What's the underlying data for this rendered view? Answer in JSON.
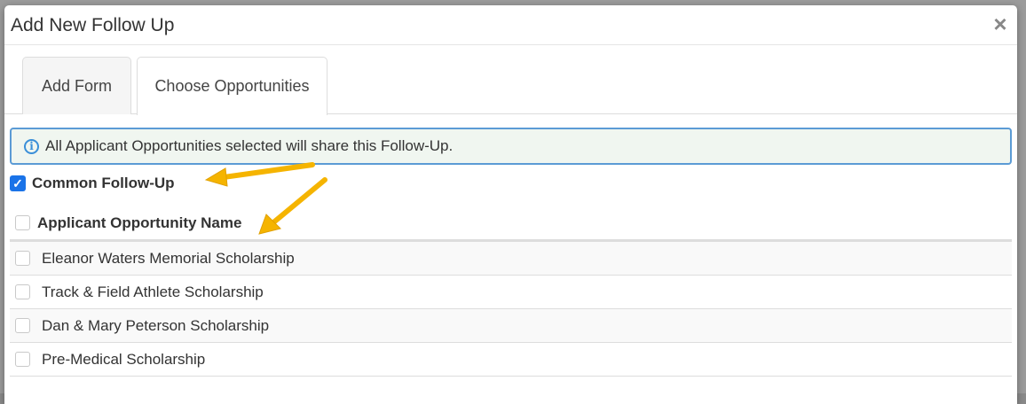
{
  "modal": {
    "title": "Add New Follow Up",
    "close_symbol": "×"
  },
  "tabs": [
    {
      "label": "Add Form",
      "active": false
    },
    {
      "label": "Choose Opportunities",
      "active": true
    }
  ],
  "alert": {
    "icon": "info-icon",
    "icon_glyph": "i",
    "text": "All Applicant Opportunities selected will share this Follow-Up."
  },
  "common_follow_up": {
    "label": "Common Follow-Up",
    "checked": true,
    "check_glyph": "✓"
  },
  "table": {
    "header": "Applicant Opportunity Name",
    "rows": [
      {
        "name": "Eleanor Waters Memorial Scholarship",
        "checked": false
      },
      {
        "name": "Track & Field Athlete Scholarship",
        "checked": false
      },
      {
        "name": "Dan & Mary Peterson Scholarship",
        "checked": false
      },
      {
        "name": "Pre-Medical Scholarship",
        "checked": false
      }
    ]
  },
  "colors": {
    "accent": "#1a73e8",
    "alert_border": "#5b9bd5",
    "annotation_arrow": "#f5b400"
  }
}
